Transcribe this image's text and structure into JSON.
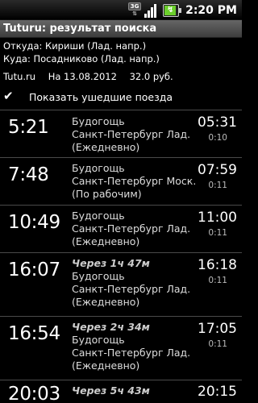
{
  "status_bar": {
    "network_label": "3G",
    "time": "2:20",
    "time_suffix": "PM",
    "battery_level": 0.85
  },
  "title": "Tuturu: результат поиска",
  "route": {
    "from": "Откуда: Кириши (Лад. напр.)",
    "to": "Куда: Посадниково (Лад. напр.)"
  },
  "info": {
    "source": "Tutu.ru",
    "date": "На 13.08.2012",
    "price": "32.0 руб."
  },
  "show_departed": {
    "label": "Показать ушедшие поезда",
    "checked": true
  },
  "trains": [
    {
      "departure": "5:21",
      "in": "",
      "route_line1": "Будогощь",
      "route_line2": "Санкт-Петербург Лад.",
      "schedule": "(Ежедневно)",
      "arrival": "05:31",
      "duration": "0:10"
    },
    {
      "departure": "7:48",
      "in": "",
      "route_line1": "Будогощь",
      "route_line2": "Санкт-Петербург Моск.",
      "schedule": "(По рабочим)",
      "arrival": "07:59",
      "duration": "0:11"
    },
    {
      "departure": "10:49",
      "in": "",
      "route_line1": "Будогощь",
      "route_line2": "Санкт-Петербург Лад.",
      "schedule": "(Ежедневно)",
      "arrival": "11:00",
      "duration": "0:11"
    },
    {
      "departure": "16:07",
      "in": "Через 1ч 47м",
      "route_line1": "Будогощь",
      "route_line2": "Санкт-Петербург Лад.",
      "schedule": "(Ежедневно)",
      "arrival": "16:18",
      "duration": "0:11"
    },
    {
      "departure": "16:54",
      "in": "Через 2ч 34м",
      "route_line1": "Будогощь",
      "route_line2": "Санкт-Петербург Лад.",
      "schedule": "(Ежедневно)",
      "arrival": "17:05",
      "duration": "0:11"
    },
    {
      "departure": "20:03",
      "in": "Через 5ч 43м",
      "route_line1": "",
      "route_line2": "",
      "schedule": "",
      "arrival": "20:15",
      "duration": ""
    }
  ]
}
